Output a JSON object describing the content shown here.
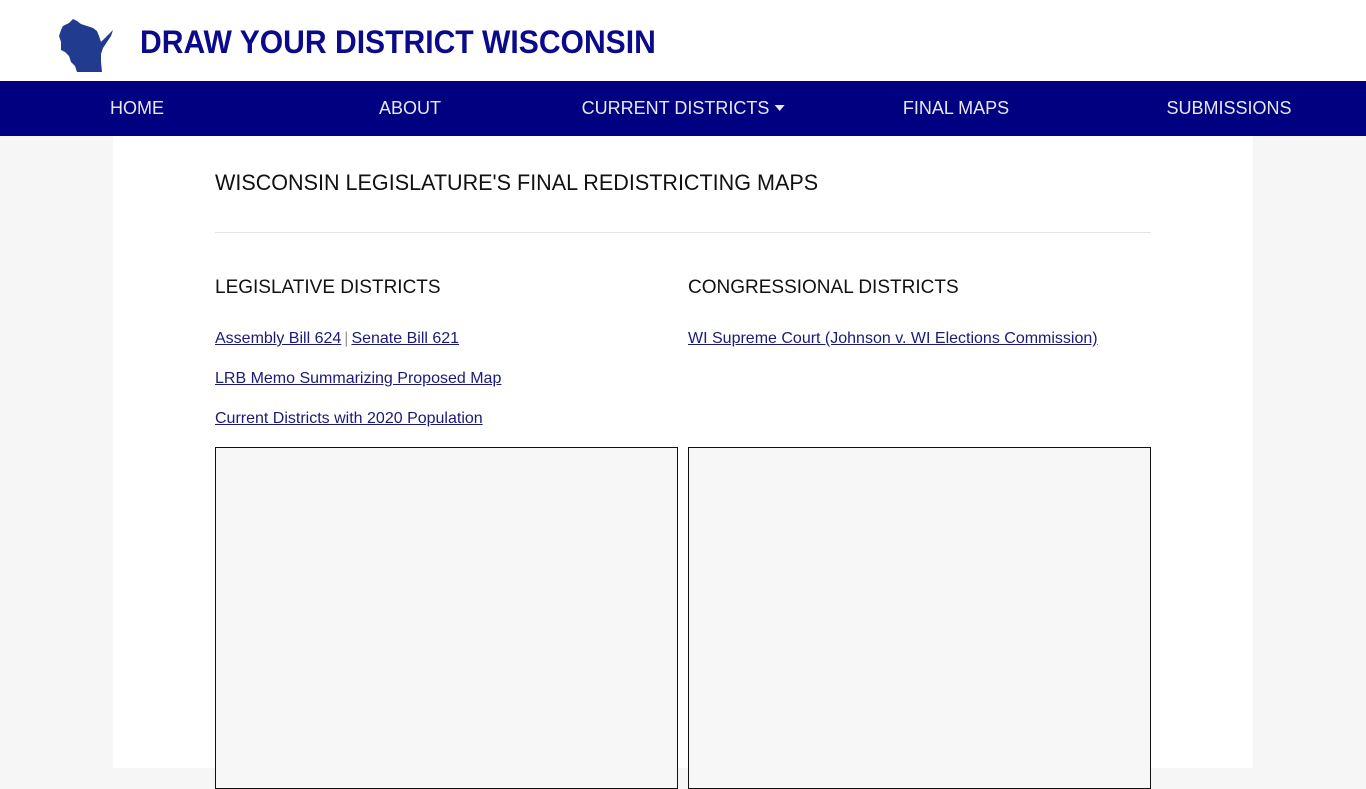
{
  "header": {
    "logo_icon": "wisconsin-state-shape-icon",
    "title": "DRAW YOUR DISTRICT WISCONSIN",
    "brand_color": "#0a0a8a"
  },
  "nav": {
    "background": "#000080",
    "items": [
      {
        "label": "HOME"
      },
      {
        "label": "ABOUT"
      },
      {
        "label": "CURRENT DISTRICTS",
        "has_dropdown": true
      },
      {
        "label": "FINAL MAPS"
      },
      {
        "label": "SUBMISSIONS"
      }
    ]
  },
  "main": {
    "page_title": "WISCONSIN LEGISLATURE'S FINAL REDISTRICTING MAPS",
    "legislative": {
      "heading": "LEGISLATIVE DISTRICTS",
      "links": {
        "assembly_bill": "Assembly Bill 624",
        "separator": "|",
        "senate_bill": "Senate Bill 621",
        "lrb_memo": "LRB Memo Summarizing Proposed Map",
        "current_districts": "Current Districts with 2020 Population"
      }
    },
    "congressional": {
      "heading": "CONGRESSIONAL DISTRICTS",
      "links": {
        "supreme_court": "WI Supreme Court (Johnson v. WI Elections Commission)"
      }
    }
  }
}
